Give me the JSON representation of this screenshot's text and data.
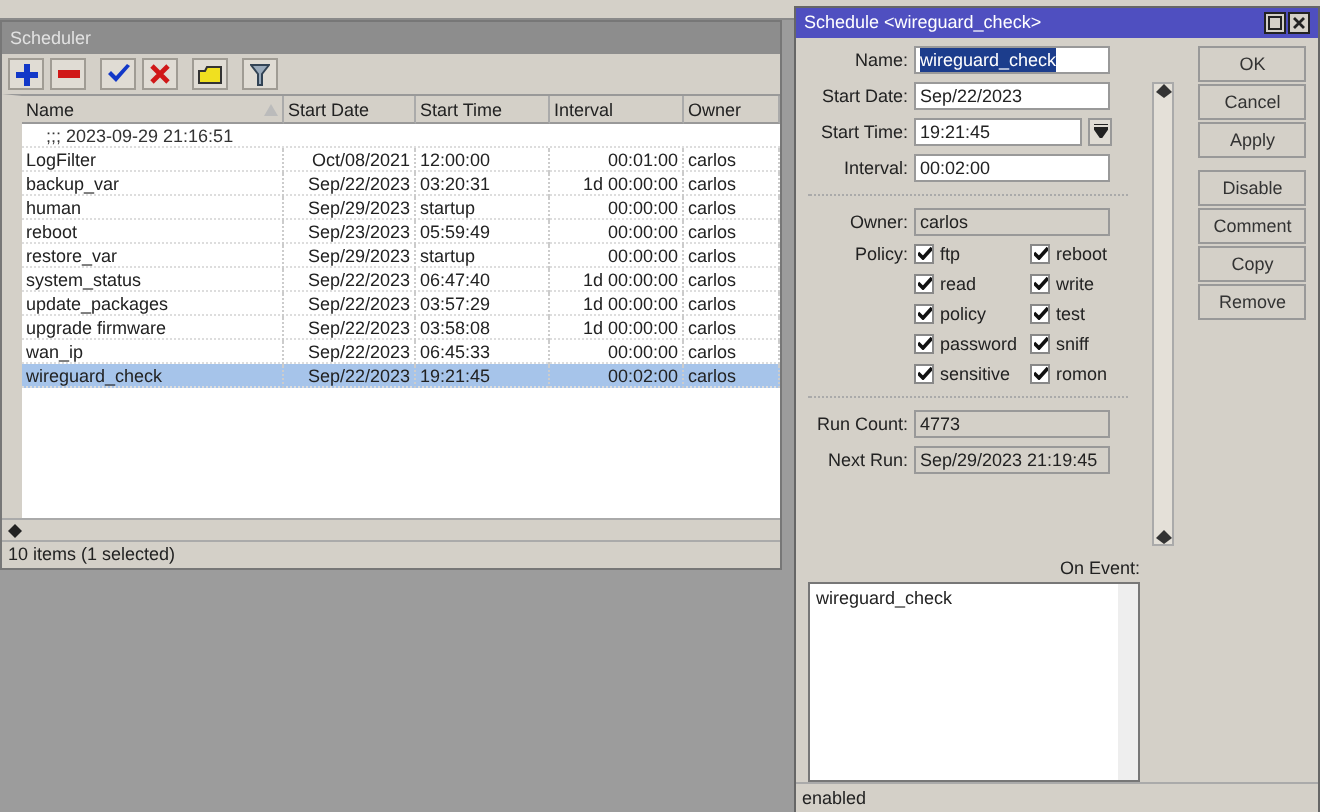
{
  "scheduler": {
    "title": "Scheduler",
    "columns": [
      {
        "label": "Name",
        "sorted": true
      },
      {
        "label": "Start Date",
        "sorted": false
      },
      {
        "label": "Start Time",
        "sorted": false
      },
      {
        "label": "Interval",
        "sorted": false
      },
      {
        "label": "Owner",
        "sorted": false
      }
    ],
    "comment": ";;; 2023-09-29 21:16:51",
    "rows": [
      {
        "name": "LogFilter",
        "start_date": "Oct/08/2021",
        "start_time": "12:00:00",
        "interval": "00:01:00",
        "owner": "carlos",
        "selected": false
      },
      {
        "name": "backup_var",
        "start_date": "Sep/22/2023",
        "start_time": "03:20:31",
        "interval": "1d 00:00:00",
        "owner": "carlos",
        "selected": false
      },
      {
        "name": "human",
        "start_date": "Sep/29/2023",
        "start_time": "startup",
        "interval": "00:00:00",
        "owner": "carlos",
        "selected": false
      },
      {
        "name": "reboot",
        "start_date": "Sep/23/2023",
        "start_time": "05:59:49",
        "interval": "00:00:00",
        "owner": "carlos",
        "selected": false
      },
      {
        "name": "restore_var",
        "start_date": "Sep/29/2023",
        "start_time": "startup",
        "interval": "00:00:00",
        "owner": "carlos",
        "selected": false
      },
      {
        "name": "system_status",
        "start_date": "Sep/22/2023",
        "start_time": "06:47:40",
        "interval": "1d 00:00:00",
        "owner": "carlos",
        "selected": false
      },
      {
        "name": "update_packages",
        "start_date": "Sep/22/2023",
        "start_time": "03:57:29",
        "interval": "1d 00:00:00",
        "owner": "carlos",
        "selected": false
      },
      {
        "name": "upgrade firmware",
        "start_date": "Sep/22/2023",
        "start_time": "03:58:08",
        "interval": "1d 00:00:00",
        "owner": "carlos",
        "selected": false
      },
      {
        "name": "wan_ip",
        "start_date": "Sep/22/2023",
        "start_time": "06:45:33",
        "interval": "00:00:00",
        "owner": "carlos",
        "selected": false
      },
      {
        "name": "wireguard_check",
        "start_date": "Sep/22/2023",
        "start_time": "19:21:45",
        "interval": "00:02:00",
        "owner": "carlos",
        "selected": true
      }
    ],
    "status": "10 items (1 selected)"
  },
  "dialog": {
    "title": "Schedule <wireguard_check>",
    "fields": [
      {
        "label": "Name:",
        "value": "wireguard_check",
        "kind": "text",
        "text_selected": true
      },
      {
        "label": "Start Date:",
        "value": "Sep/22/2023",
        "kind": "text",
        "text_selected": false
      },
      {
        "label": "Start Time:",
        "value": "19:21:45",
        "kind": "dropdown",
        "text_selected": false
      },
      {
        "label": "Interval:",
        "value": "00:02:00",
        "kind": "text",
        "text_selected": false
      }
    ],
    "owner": {
      "label": "Owner:",
      "value": "carlos"
    },
    "policy_label": "Policy:",
    "policies": [
      {
        "label": "ftp",
        "checked": true
      },
      {
        "label": "reboot",
        "checked": true
      },
      {
        "label": "read",
        "checked": true
      },
      {
        "label": "write",
        "checked": true
      },
      {
        "label": "policy",
        "checked": true
      },
      {
        "label": "test",
        "checked": true
      },
      {
        "label": "password",
        "checked": true
      },
      {
        "label": "sniff",
        "checked": true
      },
      {
        "label": "sensitive",
        "checked": true
      },
      {
        "label": "romon",
        "checked": true
      }
    ],
    "run_info": [
      {
        "label": "Run Count:",
        "value": "4773"
      },
      {
        "label": "Next Run:",
        "value": "Sep/29/2023 21:19:45"
      }
    ],
    "buttons": [
      "OK",
      "Cancel",
      "Apply"
    ],
    "item_buttons": [
      "Disable",
      "Comment",
      "Copy",
      "Remove"
    ],
    "on_event": {
      "label": "On Event:",
      "value": "wireguard_check"
    },
    "status": "enabled"
  }
}
